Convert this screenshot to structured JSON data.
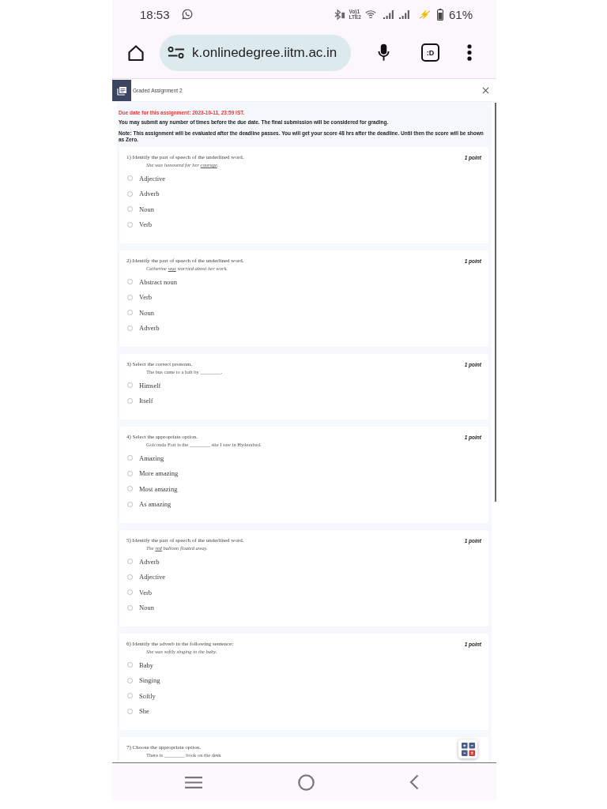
{
  "status_bar": {
    "time": "18:53",
    "network_top": "Vo)1",
    "network_bottom": "LTE2",
    "battery_percent": "61%"
  },
  "browser": {
    "url": "k.onlinedegree.iitm.ac.in",
    "tab_count": ":D"
  },
  "assignment": {
    "title": "Graded Assignment 2",
    "due_notice": "Due date for this assignment: 2023-10-11, 23:59 IST.",
    "submit_notice": "You may submit any number of times before the due date. The final submission will be considered for grading.",
    "evaluation_note": "Note: This assignment will be evaluated after the deadline passes. You will get your score 48 hrs after the deadline. Until then the score will be shown as Zero."
  },
  "questions": [
    {
      "prompt": "1) Identify the part of speech of the underlined word.",
      "points": "1 point",
      "kind": "example",
      "sentence": {
        "before": "She was honoured for her ",
        "target": "courage",
        "after": "."
      },
      "options": [
        {
          "label": "Adjective",
          "selected": false
        },
        {
          "label": "Adverb",
          "selected": false
        },
        {
          "label": "Noun",
          "selected": false
        },
        {
          "label": "Verb",
          "selected": false
        }
      ]
    },
    {
      "prompt": "2) Identify the part of speech of the underlined word.",
      "points": "1 point",
      "kind": "example",
      "sentence": {
        "before": "Catherine ",
        "target": "was",
        "after": " worried about her work."
      },
      "options": [
        {
          "label": "Abstract noun",
          "selected": false
        },
        {
          "label": "Verb",
          "selected": false
        },
        {
          "label": "Noun",
          "selected": false
        },
        {
          "label": "Adverb",
          "selected": false
        }
      ]
    },
    {
      "prompt": "3) Select the correct pronoun.",
      "points": "1 point",
      "kind": "blank",
      "sentence": {
        "before": "The bus came to a halt by ________."
      },
      "options": [
        {
          "label": "Himself",
          "selected": false
        },
        {
          "label": "Itself",
          "selected": false
        }
      ]
    },
    {
      "prompt": "4) Select the appropriate option.",
      "points": "1 point",
      "kind": "blank",
      "sentence": {
        "before": "Golconda Fort is the ________ site I saw in Hyderabad."
      },
      "options": [
        {
          "label": "Amazing",
          "selected": false
        },
        {
          "label": "More amazing",
          "selected": false
        },
        {
          "label": "Most amazing",
          "selected": false
        },
        {
          "label": "As amazing",
          "selected": false
        }
      ]
    },
    {
      "prompt": "5) Identify the part of speech of the underlined word.",
      "points": "1 point",
      "kind": "example",
      "sentence": {
        "before": "The ",
        "target": "red",
        "after": " balloon floated away."
      },
      "options": [
        {
          "label": "Adverb",
          "selected": false
        },
        {
          "label": "Adjective",
          "selected": false
        },
        {
          "label": "Verb",
          "selected": false
        },
        {
          "label": "Noun",
          "selected": false
        }
      ]
    },
    {
      "prompt": "6) Identify the adverb in the following sentence:",
      "points": "1 point",
      "kind": "example",
      "sentence": {
        "before": "She was softly singing to the baby."
      },
      "options": [
        {
          "label": "Baby",
          "selected": false
        },
        {
          "label": "Singing",
          "selected": false
        },
        {
          "label": "Softly",
          "selected": false
        },
        {
          "label": "She",
          "selected": false
        }
      ]
    },
    {
      "prompt": "7) Choose the appropriate option.",
      "kind": "blank",
      "sentence": {
        "before": "There is ________ book on the desk"
      }
    }
  ]
}
